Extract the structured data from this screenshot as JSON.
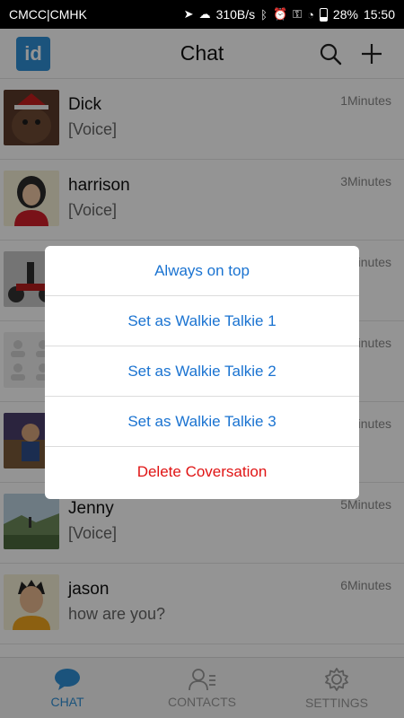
{
  "status_bar": {
    "carrier": "CMCC|CMHK",
    "speed": "310B/s",
    "battery": "28%",
    "time": "15:50"
  },
  "header": {
    "logo_text": "id",
    "title": "Chat"
  },
  "chats": [
    {
      "name": "Dick",
      "time": "1Minutes",
      "message": "[Voice]"
    },
    {
      "name": "harrison",
      "time": "3Minutes",
      "message": "[Voice]"
    },
    {
      "name": "",
      "time": "4Minutes",
      "message": ""
    },
    {
      "name": "",
      "time": "4Minutes",
      "message": ""
    },
    {
      "name": "",
      "time": "5Minutes",
      "message": ""
    },
    {
      "name": "Jenny",
      "time": "5Minutes",
      "message": "[Voice]"
    },
    {
      "name": "jason",
      "time": "6Minutes",
      "message": "how are you?"
    }
  ],
  "bottom_nav": {
    "chat": "CHAT",
    "contacts": "CONTACTS",
    "settings": "SETTINGS"
  },
  "dialog": {
    "items": [
      "Always on top",
      "Set as Walkie Talkie 1",
      "Set as Walkie Talkie 2",
      "Set as Walkie Talkie 3",
      "Delete Coversation"
    ]
  },
  "colors": {
    "accent": "#2f8fd6",
    "dialog_text": "#1a73d1",
    "danger": "#e01414"
  }
}
